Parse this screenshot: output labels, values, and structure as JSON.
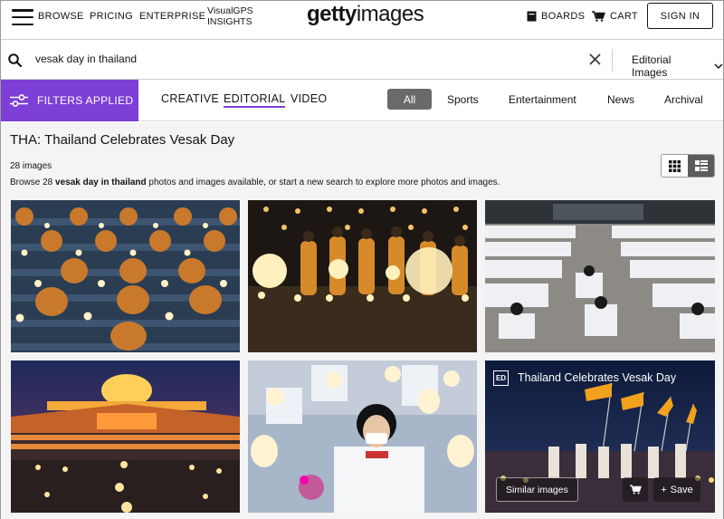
{
  "header": {
    "nav": [
      "BROWSE",
      "PRICING",
      "ENTERPRISE"
    ],
    "visualgps": [
      "VisualGPS",
      "INSIGHTS"
    ],
    "logo_bold": "getty",
    "logo_light": "images",
    "boards_label": "BOARDS",
    "cart_label": "CART",
    "signin_label": "SIGN IN"
  },
  "search": {
    "query": "vesak day in thailand",
    "scope": "Editorial Images"
  },
  "filters": {
    "button_label": "FILTERS APPLIED",
    "asset_tabs": [
      "CREATIVE",
      "EDITORIAL",
      "VIDEO"
    ],
    "active_asset_tab": "EDITORIAL",
    "chips": [
      "All",
      "Sports",
      "Entertainment",
      "News",
      "Archival"
    ],
    "active_chip": "All"
  },
  "results": {
    "title": "THA: Thailand Celebrates Vesak Day",
    "count_label": "28 images",
    "browse_prefix": "Browse 28 ",
    "browse_bold": "vesak day in thailand",
    "browse_suffix": " photos and images available, or start a new search to explore more photos and images."
  },
  "tiles": [
    {
      "name": "monks-meditating-candles-photo"
    },
    {
      "name": "monks-holding-lanterns-photo"
    },
    {
      "name": "crowd-white-robes-photo"
    },
    {
      "name": "dhammakaya-temple-night-photo"
    },
    {
      "name": "girl-praying-mask-photo"
    },
    {
      "name": "flags-procession-photo"
    }
  ],
  "hover_tile": {
    "badge": "ED",
    "title": "Thailand Celebrates Vesak Day",
    "similar_label": "Similar images",
    "save_label": "Save"
  },
  "colors": {
    "accent": "#7d3fd6",
    "chip_active": "#6a6a6a"
  }
}
